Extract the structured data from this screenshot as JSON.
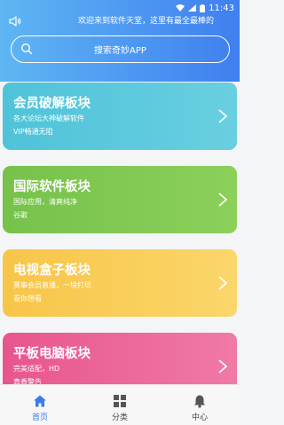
{
  "status_bar": {
    "time": "11:43"
  },
  "header": {
    "announcement": "欢迎来到软件天堂，这里有最全最棒的",
    "search_placeholder": "搜索奇妙APP"
  },
  "cards": [
    {
      "title": "会员破解板块",
      "line1": "各大论坛大神破解软件",
      "line2": "VIP畅通无阻"
    },
    {
      "title": "国际软件板块",
      "line1": "国际应用，清爽纯净",
      "line2": "谷歌"
    },
    {
      "title": "电视盒子板块",
      "line1": "赛事会员直播，一块打尽",
      "line2": "看你想看"
    },
    {
      "title": "平板电脑板块",
      "line1": "完美适配，HD",
      "line2": "真香警告"
    }
  ],
  "tabbar": {
    "tabs": [
      {
        "label": "首页",
        "icon": "home-icon",
        "active": true
      },
      {
        "label": "分类",
        "icon": "grid-icon",
        "active": false
      },
      {
        "label": "中心",
        "icon": "bell-icon",
        "active": false
      }
    ]
  },
  "colors": {
    "header_gradient": [
      "#5fb6f3",
      "#3f7ff0"
    ],
    "card_colors": [
      "#4fc3d9",
      "#76c24a",
      "#f7c548",
      "#e8558e"
    ],
    "active_tab": "#3a7be8"
  }
}
